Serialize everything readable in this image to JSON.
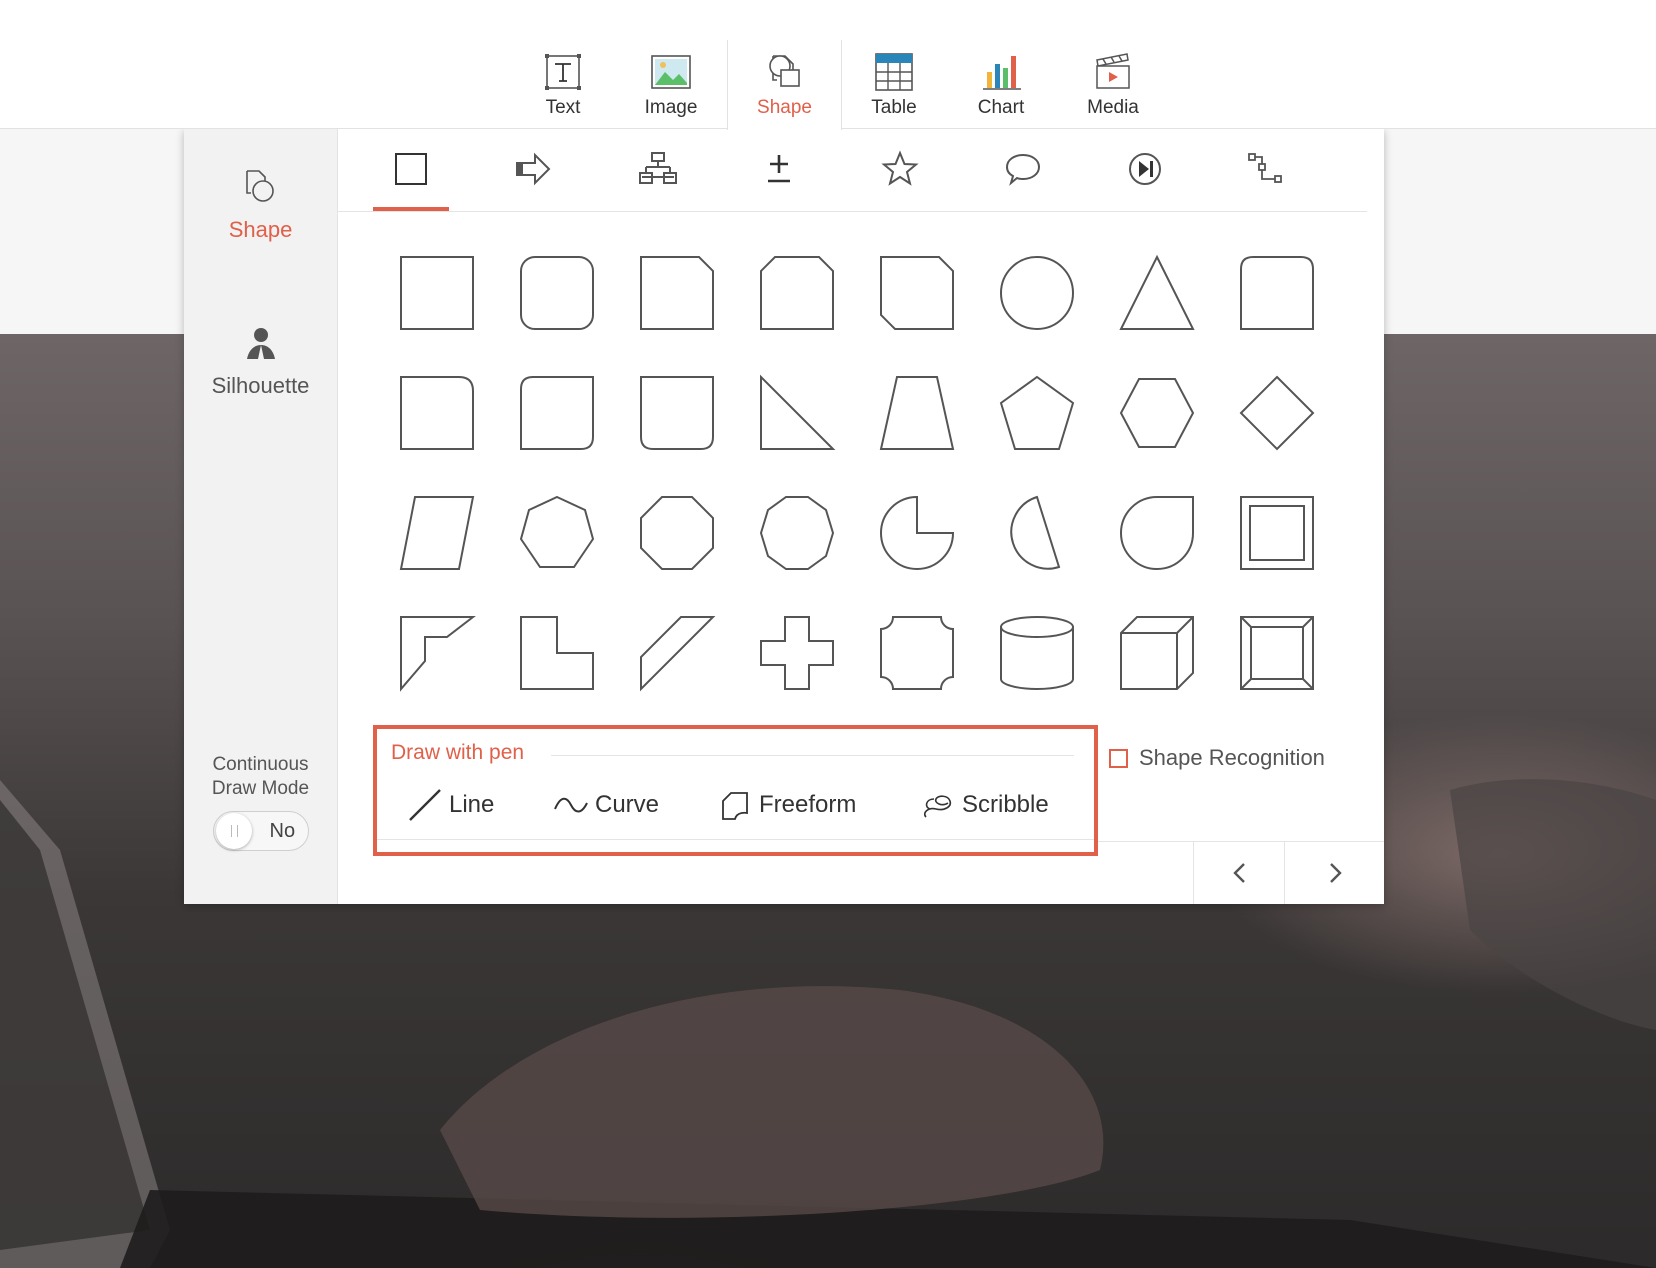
{
  "toolbar": {
    "items": [
      {
        "label": "Text",
        "icon": "text-icon"
      },
      {
        "label": "Image",
        "icon": "image-icon"
      },
      {
        "label": "Shape",
        "icon": "shape-icon"
      },
      {
        "label": "Table",
        "icon": "table-icon"
      },
      {
        "label": "Chart",
        "icon": "chart-icon"
      },
      {
        "label": "Media",
        "icon": "media-icon"
      }
    ],
    "active": "Shape"
  },
  "sidebar": {
    "items": [
      {
        "label": "Shape",
        "icon": "shape-icon"
      },
      {
        "label": "Silhouette",
        "icon": "silhouette-icon"
      }
    ],
    "active": "Shape",
    "continuous_draw": {
      "line1": "Continuous",
      "line2": "Draw Mode",
      "value": "No"
    }
  },
  "categories": [
    "basic-shapes",
    "block-arrows",
    "flowchart",
    "equation",
    "stars",
    "callouts",
    "action-buttons",
    "connectors"
  ],
  "shapes": [
    "rectangle",
    "rounded-rectangle",
    "snip-corner-rectangle",
    "snip-same-side-rectangle",
    "snip-diagonal-rectangle",
    "oval",
    "isosceles-triangle",
    "round-same-side-rectangle",
    "round-corner-rectangle",
    "round-diagonal-rectangle",
    "round-single-corner-rectangle",
    "right-triangle",
    "trapezoid",
    "pentagon",
    "hexagon",
    "diamond",
    "parallelogram",
    "heptagon",
    "octagon",
    "decagon",
    "pie",
    "chord",
    "teardrop",
    "frame",
    "half-frame",
    "l-shape",
    "diagonal-stripe",
    "cross",
    "plaque",
    "can",
    "cube",
    "bevel"
  ],
  "draw_with_pen": {
    "title": "Draw with pen",
    "tools": [
      {
        "label": "Line",
        "icon": "line-icon"
      },
      {
        "label": "Curve",
        "icon": "curve-icon"
      },
      {
        "label": "Freeform",
        "icon": "freeform-icon"
      },
      {
        "label": "Scribble",
        "icon": "scribble-icon"
      }
    ]
  },
  "shape_recognition": {
    "label": "Shape Recognition",
    "checked": false
  },
  "colors": {
    "accent": "#e0604a",
    "stroke": "#555555"
  }
}
